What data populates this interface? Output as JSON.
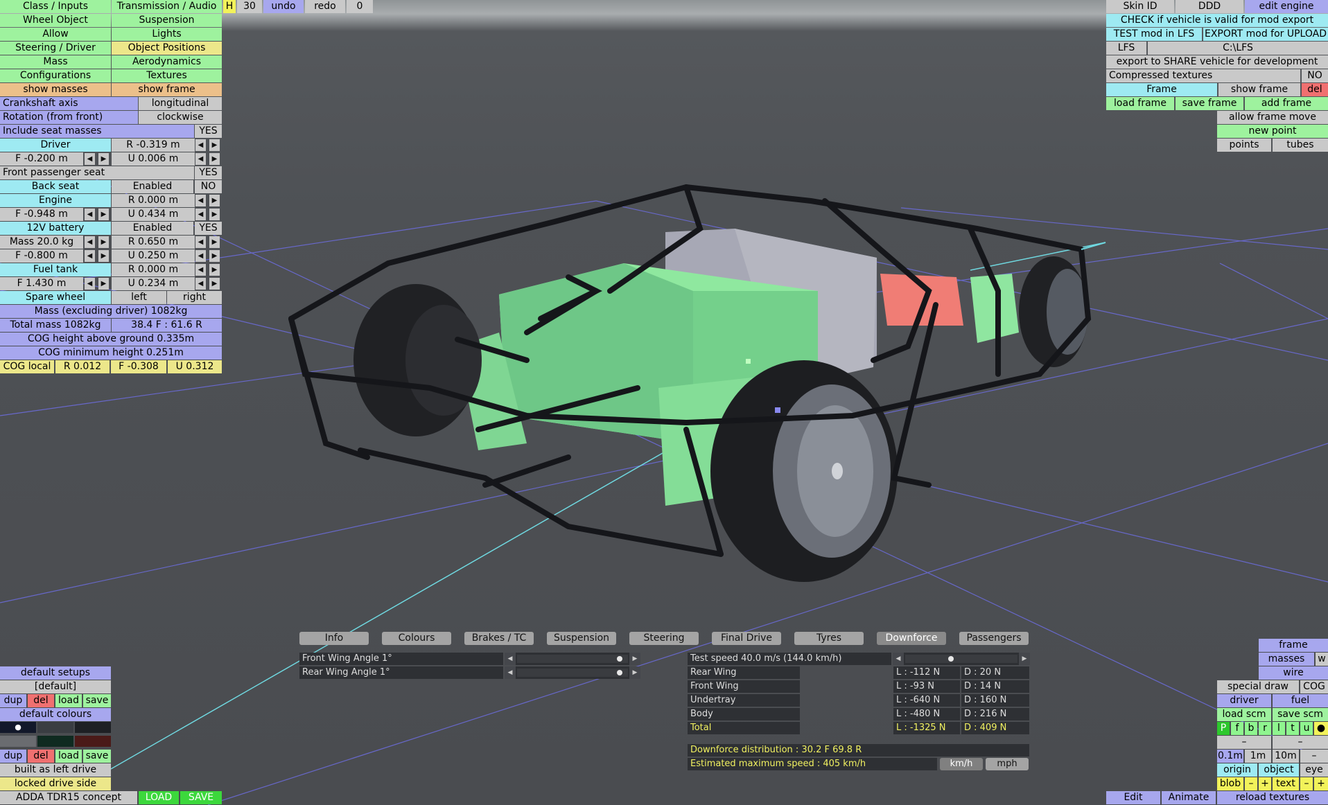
{
  "left_menu": {
    "class_inputs": "Class / Inputs",
    "transmission_audio": "Transmission / Audio",
    "wheel_object": "Wheel Object",
    "suspension": "Suspension",
    "allow": "Allow",
    "lights": "Lights",
    "steering_driver": "Steering / Driver",
    "object_positions": "Object Positions",
    "mass": "Mass",
    "aerodynamics": "Aerodynamics",
    "configurations": "Configurations",
    "textures": "Textures",
    "show_masses": "show masses",
    "show_frame": "show frame"
  },
  "top_toolbar": {
    "h": "H",
    "num": "30",
    "undo": "undo",
    "redo": "redo",
    "zero": "0"
  },
  "mass_panel": {
    "crankshaft_axis_label": "Crankshaft axis",
    "crankshaft_axis_value": "longitudinal",
    "rotation_label": "Rotation (from front)",
    "rotation_value": "clockwise",
    "include_seat_label": "Include seat masses",
    "include_seat_value": "YES",
    "driver_label": "Driver",
    "driver_r": "R -0.319 m",
    "driver_f": "F -0.200 m",
    "driver_u": "U 0.006 m",
    "front_passenger_label": "Front passenger seat",
    "front_passenger_value": "YES",
    "back_seat_label": "Back seat",
    "back_seat_state": "Enabled",
    "back_seat_value": "NO",
    "engine_label": "Engine",
    "engine_r": "R 0.000 m",
    "engine_f": "F -0.948 m",
    "engine_u": "U 0.434 m",
    "battery_label": "12V battery",
    "battery_state": "Enabled",
    "battery_value": "YES",
    "battery_mass": "Mass 20.0 kg",
    "battery_r": "R 0.650 m",
    "battery_f": "F -0.800 m",
    "battery_u": "U 0.250 m",
    "fuel_tank_label": "Fuel tank",
    "fuel_r": "R 0.000 m",
    "fuel_f": "F 1.430 m",
    "fuel_u": "U 0.234 m",
    "spare_wheel_label": "Spare wheel",
    "spare_left": "left",
    "spare_right": "right",
    "mass_excl": "Mass (excluding driver) 1082kg",
    "total_mass": "Total mass 1082kg",
    "distribution": "38.4 F : 61.6 R",
    "cog_height": "COG height above ground 0.335m",
    "cog_min": "COG minimum height 0.251m",
    "cog_local": "COG local",
    "cog_r": "R 0.012",
    "cog_f": "F -0.308",
    "cog_u": "U 0.312"
  },
  "arrows": {
    "left": "◀",
    "right": "▶"
  },
  "right_panel": {
    "skin_id": "Skin ID",
    "ddd": "DDD",
    "edit_engine": "edit engine",
    "check_valid": "CHECK if vehicle is valid for mod export",
    "test_mod": "TEST mod in LFS",
    "export_mod": "EXPORT mod for UPLOAD",
    "lfs": "LFS",
    "lfs_path": "C:\\LFS",
    "export_share": "export to SHARE vehicle for development",
    "compressed_textures": "Compressed textures",
    "compressed_value": "NO",
    "frame": "Frame",
    "show_frame": "show frame",
    "del": "del",
    "load_frame": "load frame",
    "save_frame": "save frame",
    "add_frame": "add frame",
    "allow_frame_move": "allow frame move",
    "new_point": "new point",
    "points": "points",
    "tubes": "tubes"
  },
  "tabs": [
    {
      "label": "Info"
    },
    {
      "label": "Colours"
    },
    {
      "label": "Brakes / TC"
    },
    {
      "label": "Suspension"
    },
    {
      "label": "Steering"
    },
    {
      "label": "Final Drive"
    },
    {
      "label": "Tyres"
    },
    {
      "label": "Downforce",
      "active": true
    },
    {
      "label": "Passengers"
    }
  ],
  "downforce": {
    "front_wing": "Front Wing Angle 1°",
    "rear_wing": "Rear Wing Angle 1°",
    "front_wing_level": 0.95,
    "rear_wing_level": 0.95,
    "test_speed": "Test speed 40.0 m/s (144.0 km/h)",
    "test_speed_level": 0.4,
    "rows": [
      {
        "name": "Rear Wing",
        "l": "L : -112 N",
        "d": "D : 20 N"
      },
      {
        "name": "Front Wing",
        "l": "L : -93 N",
        "d": "D : 14 N"
      },
      {
        "name": "Undertray",
        "l": "L : -640 N",
        "d": "D : 160 N"
      },
      {
        "name": "Body",
        "l": "L : -480 N",
        "d": "D : 216 N"
      },
      {
        "name": "Total",
        "l": "L : -1325 N",
        "d": "D : 409 N"
      }
    ],
    "distribution": "Downforce distribution : 30.2 F  69.8 R",
    "max_speed": "Estimated maximum speed : 405 km/h",
    "kmh": "km/h",
    "mph": "mph"
  },
  "bottom_left": {
    "default_setups": "default setups",
    "default": "[default]",
    "dup": "dup",
    "del": "del",
    "load": "load",
    "save": "save",
    "default_colours": "default colours",
    "dot": "●",
    "built_as": "built as left drive",
    "locked_drive": "locked drive side",
    "vehicle_name": "ADDA TDR15 concept",
    "load_btn": "LOAD",
    "save_btn": "SAVE"
  },
  "bottom_right": {
    "frame": "frame",
    "masses": "masses",
    "w": "w",
    "wire": "wire",
    "special_draw": "special draw",
    "cog": "COG",
    "driver": "driver",
    "fuel": "fuel",
    "load_scm": "load scm",
    "save_scm": "save scm",
    "letters": [
      "P",
      "f",
      "b",
      "r",
      "l",
      "t",
      "u"
    ],
    "dot": "●",
    "dash": "–",
    "step_01": "0.1m",
    "step_1": "1m",
    "step_10": "10m",
    "origin": "origin",
    "object": "object",
    "eye": "eye",
    "blob": "blob",
    "minus": "–",
    "plus": "+",
    "text": "text",
    "edit": "Edit",
    "animate": "Animate",
    "reload_textures": "reload textures"
  },
  "colors": {
    "green": "#9ef29e",
    "yellow": "#ece78a",
    "blue": "#a7a7ee",
    "cyan": "#9eeaf2",
    "grey": "#c9c9c9",
    "orange": "#ecc08a",
    "red": "#f07070"
  }
}
